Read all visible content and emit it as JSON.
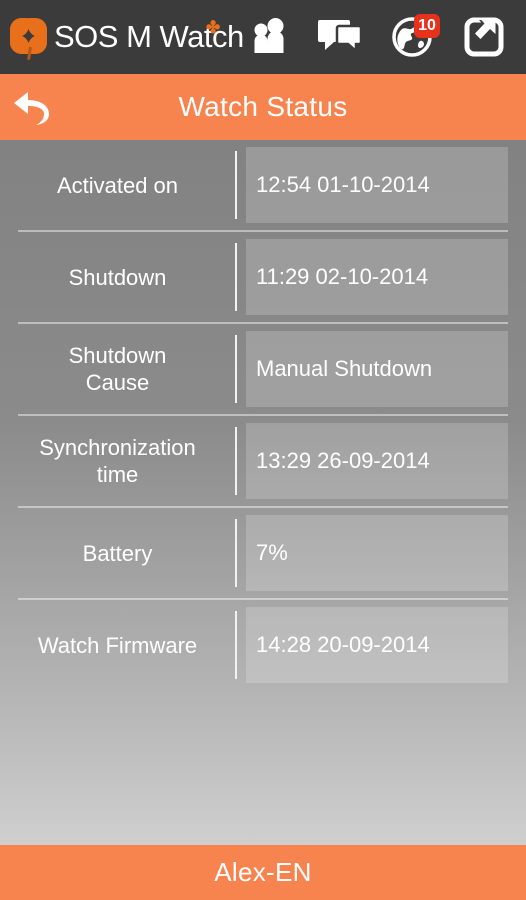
{
  "appbar": {
    "brand_name": "SOS M Watch",
    "brand_mark": "✤",
    "logo_icon": "clover-logo",
    "icons": [
      {
        "name": "contacts-icon",
        "label": "Contacts"
      },
      {
        "name": "messages-icon",
        "label": "Messages"
      },
      {
        "name": "globe-icon",
        "label": "Events",
        "badge": "10"
      },
      {
        "name": "share-location-icon",
        "label": "Share"
      }
    ]
  },
  "titlebar": {
    "back_icon": "back-arrow-icon",
    "title": "Watch Status"
  },
  "status": {
    "rows": [
      {
        "label": "Activated on",
        "value": "12:54 01-10-2014"
      },
      {
        "label": "Shutdown",
        "value": "11:29 02-10-2014"
      },
      {
        "label": "Shutdown\nCause",
        "value": "Manual Shutdown"
      },
      {
        "label": "Synchronization\ntime",
        "value": "13:29 26-09-2014"
      },
      {
        "label": "Battery",
        "value": "7%"
      },
      {
        "label": "Watch Firmware",
        "value": "14:28 20-09-2014"
      }
    ]
  },
  "bottombar": {
    "user": "Alex-EN"
  },
  "colors": {
    "accent_orange": "#F7834F",
    "appbar_dark": "#3B3B3B",
    "badge_red": "#E8311A",
    "logo_orange": "#E8701A"
  }
}
